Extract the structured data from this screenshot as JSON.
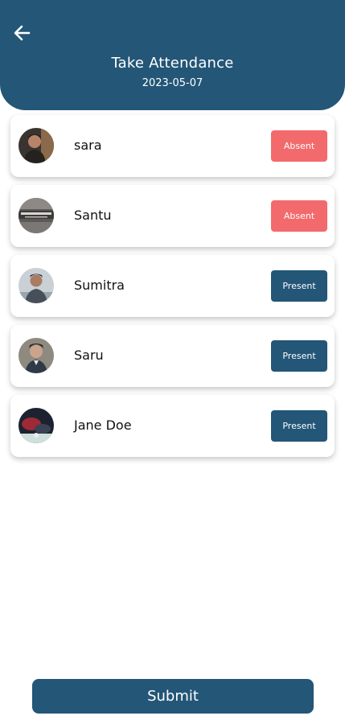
{
  "header": {
    "title": "Take Attendance",
    "date": "2023-05-07",
    "back_icon": "arrow-left-icon"
  },
  "students": [
    {
      "name": "sara",
      "status": "Absent"
    },
    {
      "name": "Santu",
      "status": "Absent"
    },
    {
      "name": "Sumitra",
      "status": "Present"
    },
    {
      "name": "Saru",
      "status": "Present"
    },
    {
      "name": "Jane Doe",
      "status": "Present"
    }
  ],
  "submit_label": "Submit",
  "colors": {
    "primary": "#235677",
    "absent": "#f36a6c"
  }
}
